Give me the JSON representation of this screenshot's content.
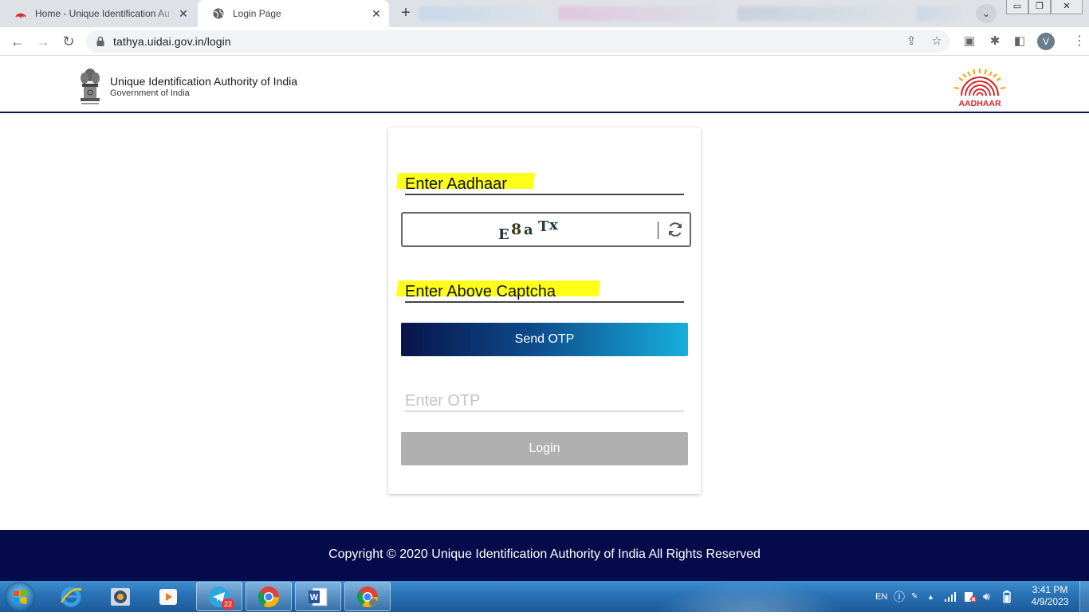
{
  "browser": {
    "tabs": [
      {
        "title": "Home - Unique Identification Au",
        "icon": "aadhaar-favicon",
        "active": false
      },
      {
        "title": "Login Page",
        "icon": "globe-icon",
        "active": true
      }
    ],
    "address": "tathya.uidai.gov.in/login",
    "profile_initial": "V"
  },
  "header": {
    "org_name": "Unique Identification Authority of India",
    "org_sub": "Government of India",
    "logo_text": "AADHAAR"
  },
  "form": {
    "aadhaar_label": "Enter Aadhaar",
    "captcha_chars": [
      "E",
      "8",
      "a",
      "T",
      "x"
    ],
    "captcha_label": "Enter Above Captcha",
    "send_otp_label": "Send OTP",
    "otp_label": "Enter OTP",
    "login_label": "Login"
  },
  "footer": {
    "copyright": "Copyright © 2020 Unique Identification Authority of India All Rights Reserved"
  },
  "taskbar": {
    "telegram_badge": "22",
    "lang": "EN",
    "time": "3:41 PM",
    "date": "4/9/2023"
  },
  "colors": {
    "highlight": "#ffff1a",
    "header_border": "#0b1a4a",
    "footer_bg": "#050a4a",
    "send_gradient_start": "#07144a",
    "send_gradient_end": "#17aedc",
    "login_disabled": "#b0b0b0"
  }
}
